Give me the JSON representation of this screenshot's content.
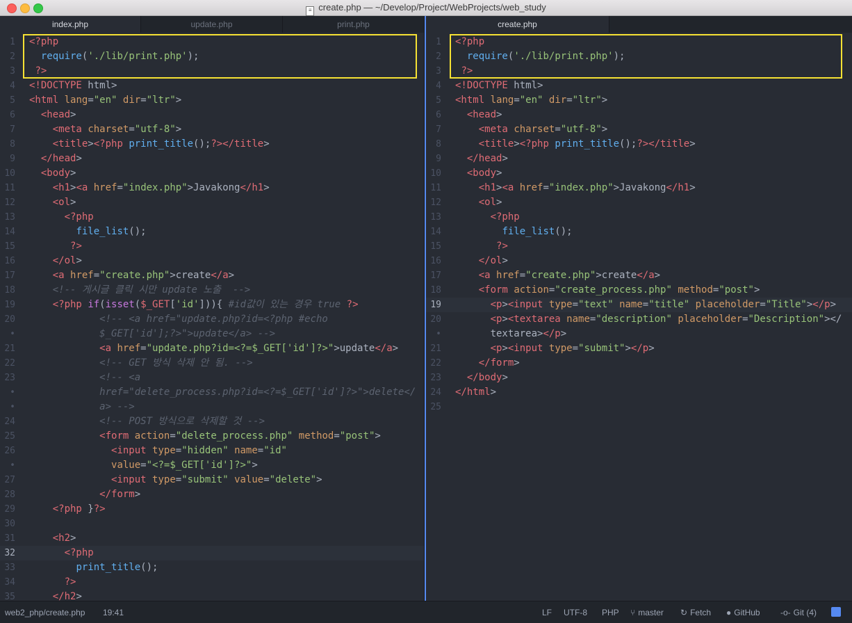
{
  "window": {
    "title": "create.php — ~/Develop/Project/WebProjects/web_study"
  },
  "tabs_left": [
    {
      "label": "index.php",
      "active": true
    },
    {
      "label": "update.php",
      "active": false
    },
    {
      "label": "print.php",
      "active": false
    }
  ],
  "tabs_right": [
    {
      "label": "create.php",
      "active": true
    }
  ],
  "colors": {
    "highlight_box": "#f6e233",
    "active_pane_accent": "#568af2"
  },
  "editor_left": {
    "file": "index.php",
    "current_line": "32",
    "lines": [
      {
        "n": "1",
        "t": "<?php"
      },
      {
        "n": "2",
        "t": "  require('./lib/print.php');"
      },
      {
        "n": "3",
        "t": " ?>"
      },
      {
        "n": "4",
        "t": "<!DOCTYPE html>"
      },
      {
        "n": "5",
        "t": "<html lang=\"en\" dir=\"ltr\">"
      },
      {
        "n": "6",
        "t": "  <head>"
      },
      {
        "n": "7",
        "t": "    <meta charset=\"utf-8\">"
      },
      {
        "n": "8",
        "t": "    <title><?php print_title();?></title>"
      },
      {
        "n": "9",
        "t": "  </head>"
      },
      {
        "n": "10",
        "t": "  <body>"
      },
      {
        "n": "11",
        "t": "    <h1><a href=\"index.php\">Javakong</h1>"
      },
      {
        "n": "12",
        "t": "    <ol>"
      },
      {
        "n": "13",
        "t": "      <?php"
      },
      {
        "n": "14",
        "t": "        file_list();"
      },
      {
        "n": "15",
        "t": "       ?>"
      },
      {
        "n": "16",
        "t": "    </ol>"
      },
      {
        "n": "17",
        "t": "    <a href=\"create.php\">create</a>"
      },
      {
        "n": "18",
        "t": "    <!-- 게시글 클릭 시만 update 노출  -->"
      },
      {
        "n": "19",
        "t": "    <?php if(isset($_GET['id'])){ #id값이 있는 경우 true ?>"
      },
      {
        "n": "20",
        "t": "            <!-- <a href=\"update.php?id=<?php #echo"
      },
      {
        "n": "•",
        "t": "            $_GET['id'];?>\">update</a> -->"
      },
      {
        "n": "21",
        "t": "            <a href=\"update.php?id=<?=$_GET['id']?>\">update</a>"
      },
      {
        "n": "22",
        "t": "            <!-- GET 방식 삭제 안 됨. -->"
      },
      {
        "n": "23",
        "t": "            <!-- <a"
      },
      {
        "n": "•",
        "t": "            href=\"delete_process.php?id=<?=$_GET['id']?>\">delete</"
      },
      {
        "n": "•",
        "t": "            a> -->"
      },
      {
        "n": "24",
        "t": "            <!-- POST 방식으로 삭제할 것 -->"
      },
      {
        "n": "25",
        "t": "            <form action=\"delete_process.php\" method=\"post\">"
      },
      {
        "n": "26",
        "t": "              <input type=\"hidden\" name=\"id\""
      },
      {
        "n": "•",
        "t": "              value=\"<?=$_GET['id']?>\">"
      },
      {
        "n": "27",
        "t": "              <input type=\"submit\" value=\"delete\">"
      },
      {
        "n": "28",
        "t": "            </form>"
      },
      {
        "n": "29",
        "t": "    <?php }?>"
      },
      {
        "n": "30",
        "t": ""
      },
      {
        "n": "31",
        "t": "    <h2>"
      },
      {
        "n": "32",
        "t": "      <?php"
      },
      {
        "n": "33",
        "t": "        print_title();"
      },
      {
        "n": "34",
        "t": "      ?>"
      },
      {
        "n": "35",
        "t": "    </h2>"
      }
    ]
  },
  "editor_right": {
    "file": "create.php",
    "current_line": "19",
    "lines": [
      {
        "n": "1",
        "t": "<?php"
      },
      {
        "n": "2",
        "t": "  require('./lib/print.php');"
      },
      {
        "n": "3",
        "t": " ?>"
      },
      {
        "n": "4",
        "t": "<!DOCTYPE html>"
      },
      {
        "n": "5",
        "t": "<html lang=\"en\" dir=\"ltr\">"
      },
      {
        "n": "6",
        "t": "  <head>"
      },
      {
        "n": "7",
        "t": "    <meta charset=\"utf-8\">"
      },
      {
        "n": "8",
        "t": "    <title><?php print_title();?></title>"
      },
      {
        "n": "9",
        "t": "  </head>"
      },
      {
        "n": "10",
        "t": "  <body>"
      },
      {
        "n": "11",
        "t": "    <h1><a href=\"index.php\">Javakong</h1>"
      },
      {
        "n": "12",
        "t": "    <ol>"
      },
      {
        "n": "13",
        "t": "      <?php"
      },
      {
        "n": "14",
        "t": "        file_list();"
      },
      {
        "n": "15",
        "t": "       ?>"
      },
      {
        "n": "16",
        "t": "    </ol>"
      },
      {
        "n": "17",
        "t": "    <a href=\"create.php\">create</a>"
      },
      {
        "n": "18",
        "t": "    <form action=\"create_process.php\" method=\"post\">"
      },
      {
        "n": "19",
        "t": "      <p><input type=\"text\" name=\"title\" placeholder=\"Title\"></p>"
      },
      {
        "n": "20",
        "t": "      <p><textarea name=\"description\" placeholder=\"Description\"></"
      },
      {
        "n": "•",
        "t": "      textarea></p>"
      },
      {
        "n": "21",
        "t": "      <p><input type=\"submit\"></p>"
      },
      {
        "n": "22",
        "t": "    </form>"
      },
      {
        "n": "23",
        "t": "  </body>"
      },
      {
        "n": "24",
        "t": "</html>"
      },
      {
        "n": "25",
        "t": ""
      }
    ]
  },
  "statusbar": {
    "path": "web2_php/create.php",
    "cursor": "19:41",
    "line_ending": "LF",
    "encoding": "UTF-8",
    "grammar": "PHP",
    "branch": "master",
    "fetch": "Fetch",
    "github": "GitHub",
    "git": "Git (4)"
  }
}
